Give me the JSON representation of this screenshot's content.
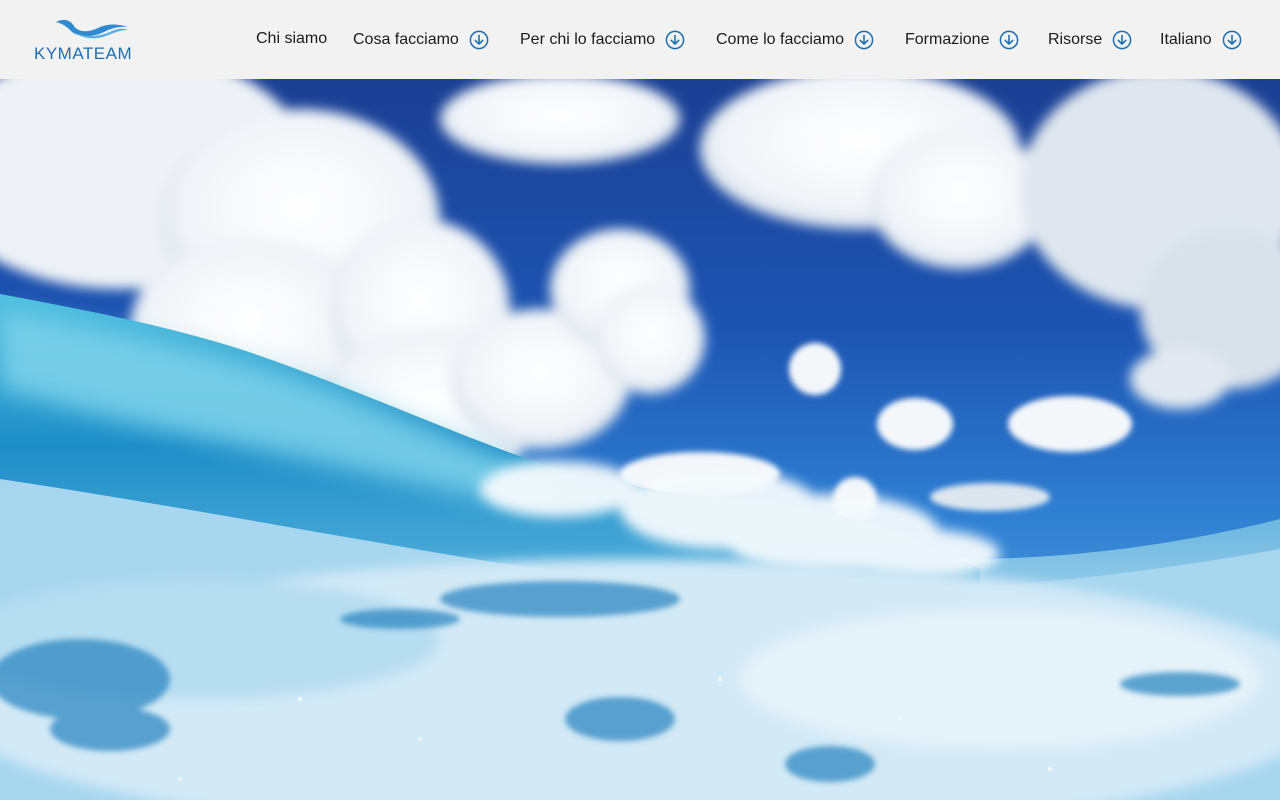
{
  "brand": {
    "name": "KYMATEAM",
    "color": "#1d6fb0"
  },
  "nav": {
    "items": [
      {
        "label": "Chi siamo",
        "dropdown": false
      },
      {
        "label": "Cosa facciamo",
        "dropdown": true
      },
      {
        "label": "Per chi lo facciamo",
        "dropdown": true
      },
      {
        "label": "Come lo facciamo",
        "dropdown": true
      },
      {
        "label": "Formazione",
        "dropdown": true
      },
      {
        "label": "Risorse",
        "dropdown": true
      },
      {
        "label": "Italiano",
        "dropdown": true
      }
    ],
    "dropdown_icon": "chevron-down-circle-icon",
    "accent": "#1d6fb0"
  },
  "hero": {
    "image": "ocean-wave-under-blue-sky-with-clouds",
    "colors": {
      "sky": "#1d58b5",
      "water": "#2fa3d6",
      "foam": "#eef6fb"
    }
  }
}
